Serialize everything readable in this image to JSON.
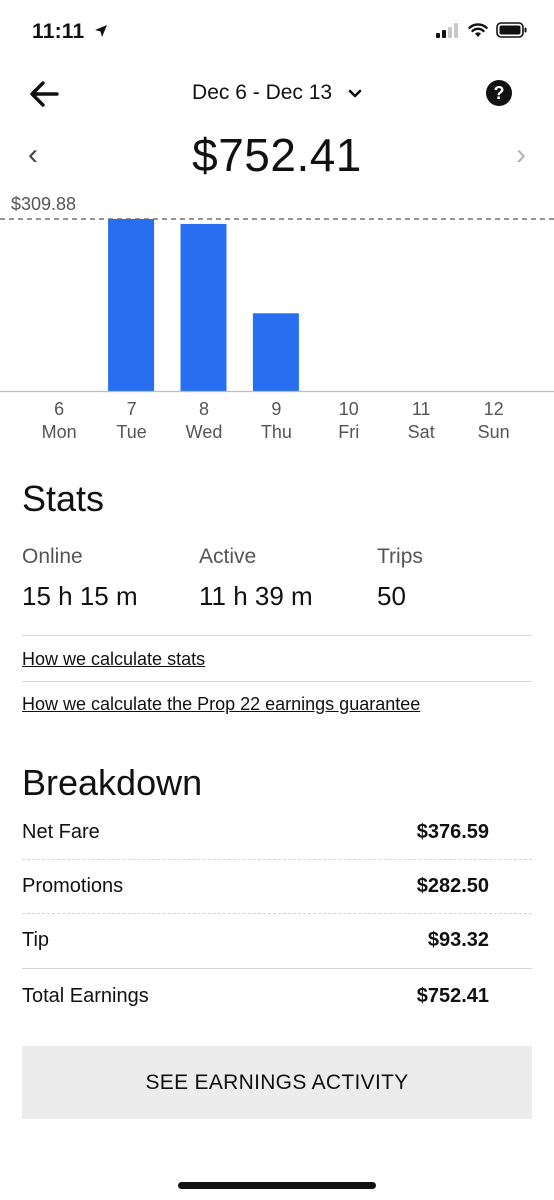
{
  "status_bar": {
    "time": "11:11"
  },
  "header": {
    "date_range": "Dec 6 - Dec 13",
    "total": "$752.41",
    "help": "?"
  },
  "chart_data": {
    "type": "bar",
    "categories": [
      "6 Mon",
      "7 Tue",
      "8 Wed",
      "9 Thu",
      "10 Fri",
      "11 Sat",
      "12 Sun"
    ],
    "day_numbers": [
      "6",
      "7",
      "8",
      "9",
      "10",
      "11",
      "12"
    ],
    "day_names": [
      "Mon",
      "Tue",
      "Wed",
      "Thu",
      "Fri",
      "Sat",
      "Sun"
    ],
    "values": [
      0,
      309.88,
      301.0,
      140.0,
      0,
      0,
      0
    ],
    "max_label": "$309.88",
    "ylim": [
      0,
      309.88
    ],
    "bar_color": "#276EF1"
  },
  "stats": {
    "title": "Stats",
    "online_label": "Online",
    "online_value": "15 h 15 m",
    "active_label": "Active",
    "active_value": "11 h 39 m",
    "trips_label": "Trips",
    "trips_value": "50",
    "link_stats": "How we calculate stats",
    "link_prop22": "How we calculate the Prop 22 earnings guarantee"
  },
  "breakdown": {
    "title": "Breakdown",
    "rows": [
      {
        "label": "Net Fare",
        "amount": "$376.59"
      },
      {
        "label": "Promotions",
        "amount": "$282.50"
      },
      {
        "label": "Tip",
        "amount": "$93.32"
      },
      {
        "label": "Total Earnings",
        "amount": "$752.41"
      }
    ]
  },
  "cta": {
    "label": "SEE EARNINGS ACTIVITY"
  },
  "icons": {
    "back": "arrow-left-icon",
    "location": "location-arrow-icon",
    "signal": "cellular-signal-icon",
    "wifi": "wifi-icon",
    "battery": "battery-icon",
    "chevron": "chevron-down-icon",
    "help": "help-circle-icon"
  }
}
